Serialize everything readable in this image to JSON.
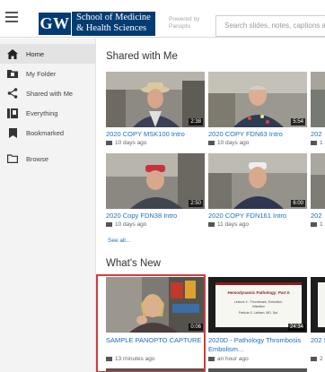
{
  "header": {
    "logo_mark": "GW",
    "logo_line1": "School of Medicine",
    "logo_line2": "& Health Sciences",
    "powered_line1": "Powered by",
    "powered_line2": "Panopto",
    "search_placeholder": "Search slides, notes, captions and more"
  },
  "sidebar": {
    "items": [
      {
        "label": "Home",
        "icon": "home-icon",
        "active": true
      },
      {
        "label": "My Folder",
        "icon": "folder-icon",
        "active": false
      },
      {
        "label": "Shared with Me",
        "icon": "share-icon",
        "active": false
      },
      {
        "label": "Everything",
        "icon": "everything-icon",
        "active": false
      },
      {
        "label": "Bookmarked",
        "icon": "bookmark-icon",
        "active": false
      },
      {
        "label": "Browse",
        "icon": "browse-icon",
        "active": false
      }
    ]
  },
  "shared": {
    "title": "Shared with Me",
    "see_all": "See all...",
    "cards": [
      {
        "title": "2020 COPY MSK100 Intro",
        "meta": "10 days ago",
        "duration": "2:38"
      },
      {
        "title": "2020 COPY FDN63 Intro",
        "meta": "10 days ago",
        "duration": "5:54"
      },
      {
        "title": "202",
        "meta": "1",
        "duration": ""
      },
      {
        "title": "2020 Copy FDN38 Intro",
        "meta": "10 days ago",
        "duration": "2:50"
      },
      {
        "title": "2020 COPY FDN161 Intro",
        "meta": "11 days ago",
        "duration": "6:00"
      },
      {
        "title": "202",
        "meta": "1",
        "duration": ""
      }
    ]
  },
  "whats_new": {
    "title": "What's New",
    "cards": [
      {
        "title": "SAMPLE PANOPTO CAPTURE",
        "meta": "13 minutes ago",
        "duration": "0:06"
      },
      {
        "title": "2020D - Pathology Thrombosis Embolism...",
        "meta": "an hour ago",
        "duration": "24:34",
        "slide_title": "Hemodynamic Pathology: Part II",
        "slide_sub1": "Lecture 3 - Thrombosis, Embolism,",
        "slide_sub2": "Infarction",
        "slide_sub3": "Patricia S. Latham, MD, Dpt."
      },
      {
        "title": "202 Sho",
        "meta": "2",
        "duration": ""
      }
    ]
  }
}
